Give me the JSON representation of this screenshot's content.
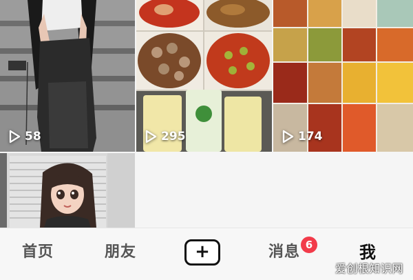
{
  "videos": [
    {
      "play_count": "58"
    },
    {
      "play_count": "295"
    },
    {
      "play_count": "174"
    },
    {
      "play_count": ""
    }
  ],
  "nav": {
    "home": "首页",
    "friends": "朋友",
    "create": "+",
    "messages": "消息",
    "messages_badge": "6",
    "me": "我"
  },
  "watermark": "爱创根知识网",
  "colors": {
    "badge": "#f23b4a",
    "nav_active": "#111111",
    "nav_inactive": "#555555"
  }
}
